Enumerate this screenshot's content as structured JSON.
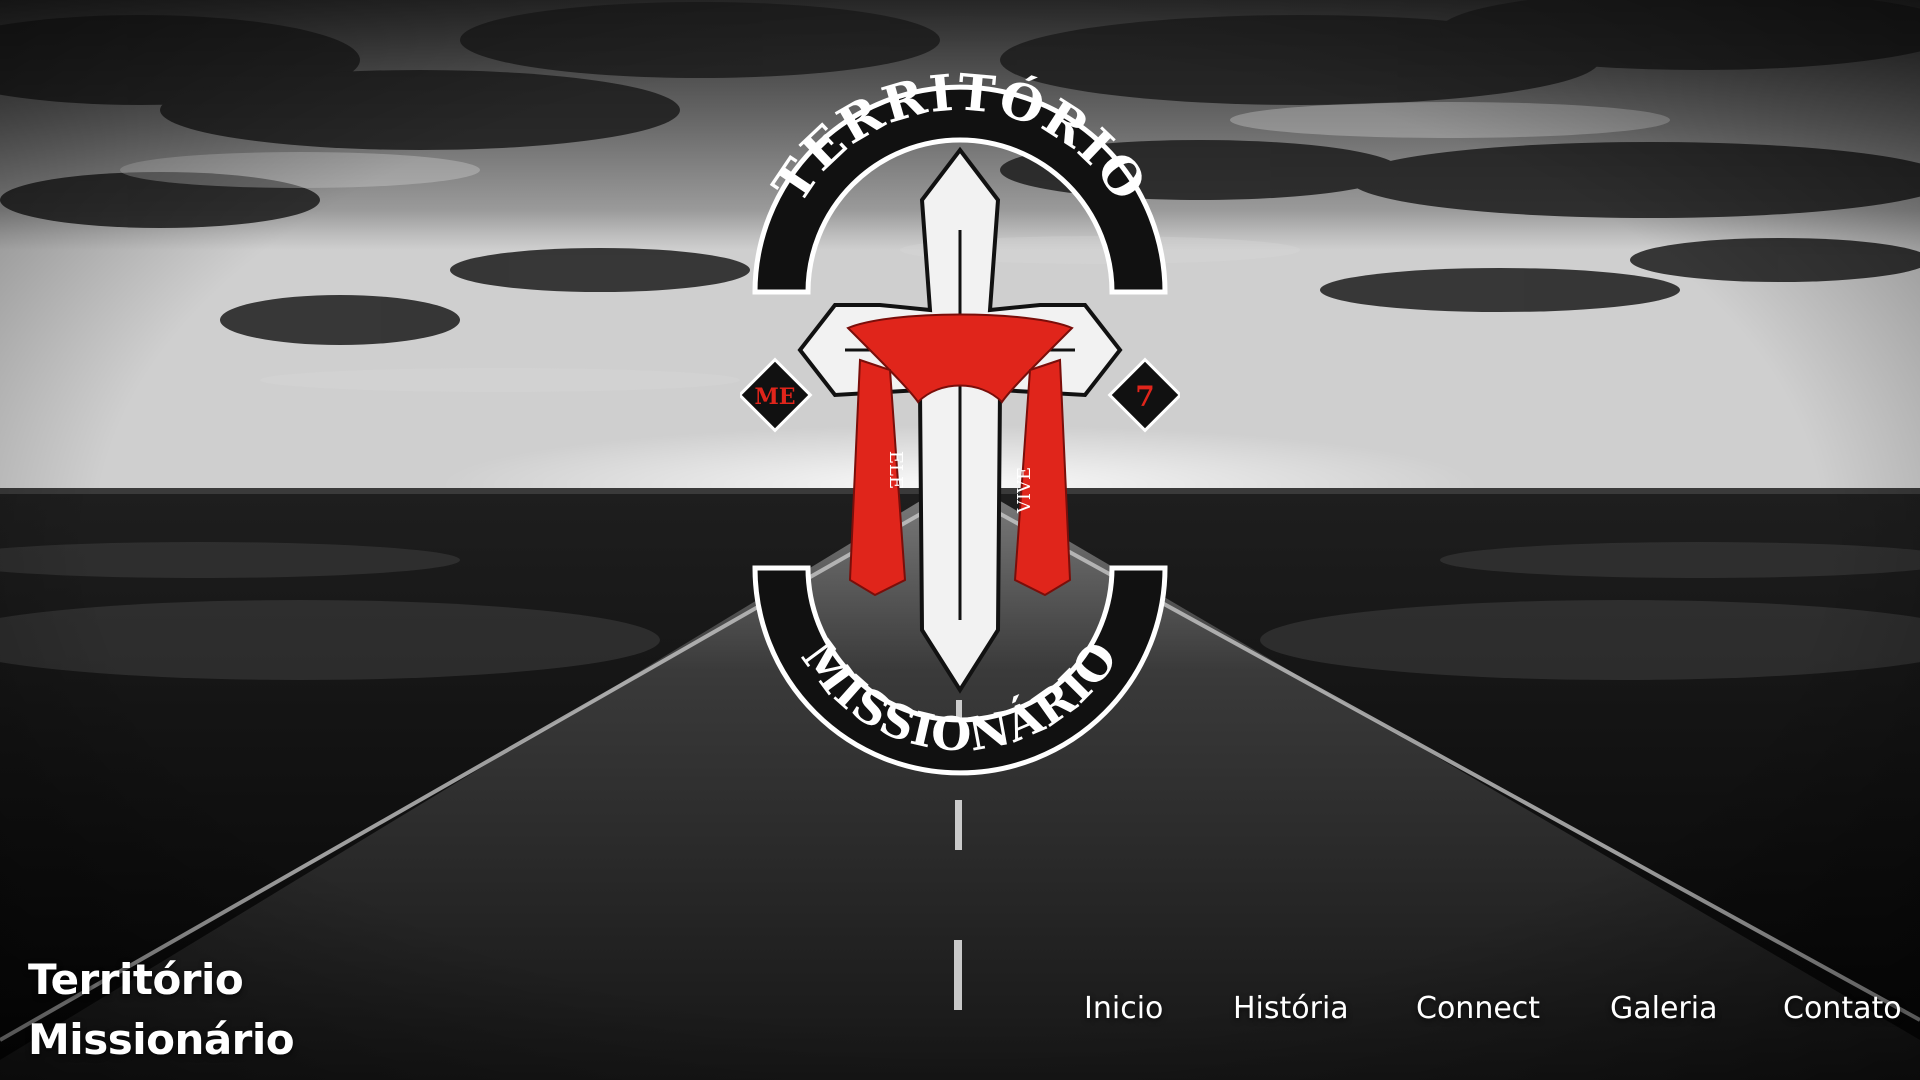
{
  "logo": {
    "top_text": "TERRITÓRIO",
    "bottom_text": "MISSIONÁRIO",
    "left_badge": "ME",
    "right_badge": "7",
    "banner_left": "ELE",
    "banner_right": "VIVE",
    "accent_color": "#e0251b"
  },
  "site": {
    "title_line1": "Território",
    "title_line2": "Missionário"
  },
  "nav": {
    "items": [
      {
        "label": "Inicio"
      },
      {
        "label": "História"
      },
      {
        "label": "Connect"
      },
      {
        "label": "Galeria"
      },
      {
        "label": "Contato"
      }
    ]
  }
}
